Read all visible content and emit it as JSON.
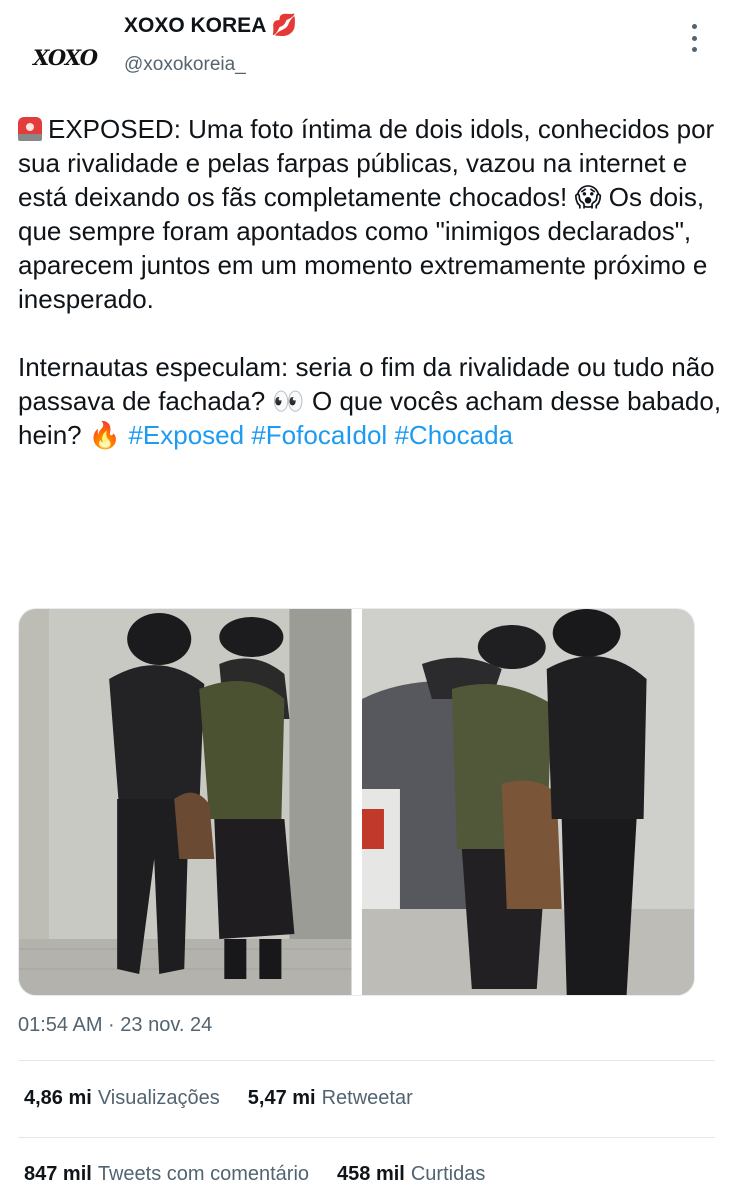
{
  "account": {
    "display_name": "XOXO KOREA 💋",
    "handle": "@xoxokoreia_",
    "avatar_text": "XOXO"
  },
  "tweet": {
    "paragraph1": "EXPOSED: Uma foto íntima de dois idols, conhecidos por sua rivalidade e pelas farpas públicas, vazou na internet e está deixando os fãs completamente chocados! 😱 Os dois, que sempre foram apontados como \"inimigos declarados\", aparecem juntos em um momento extremamente próximo e inesperado.",
    "paragraph2_text": "Internautas especulam: seria o fim da rivalidade ou tudo não passava de fachada? 👀 O que vocês acham desse babado, hein? 🔥",
    "hashtags": [
      "#Exposed",
      "#FofocaIdol",
      "#Chocada"
    ]
  },
  "timestamp": "01:54 AM · 23 nov. 24",
  "stats": {
    "views_count": "4,86 mi",
    "views_label": "Visualizações",
    "retweets_count": "5,47 mi",
    "retweets_label": "Retweetar",
    "quotes_count": "847 mil",
    "quotes_label": "Tweets com comentário",
    "likes_count": "458 mil",
    "likes_label": "Curtidas"
  },
  "icons": {
    "more": "more-vertical-icon",
    "siren": "siren-icon"
  },
  "colors": {
    "hashtag": "#1d9bf0",
    "secondary_text": "#536471",
    "primary_text": "#0f1419"
  }
}
